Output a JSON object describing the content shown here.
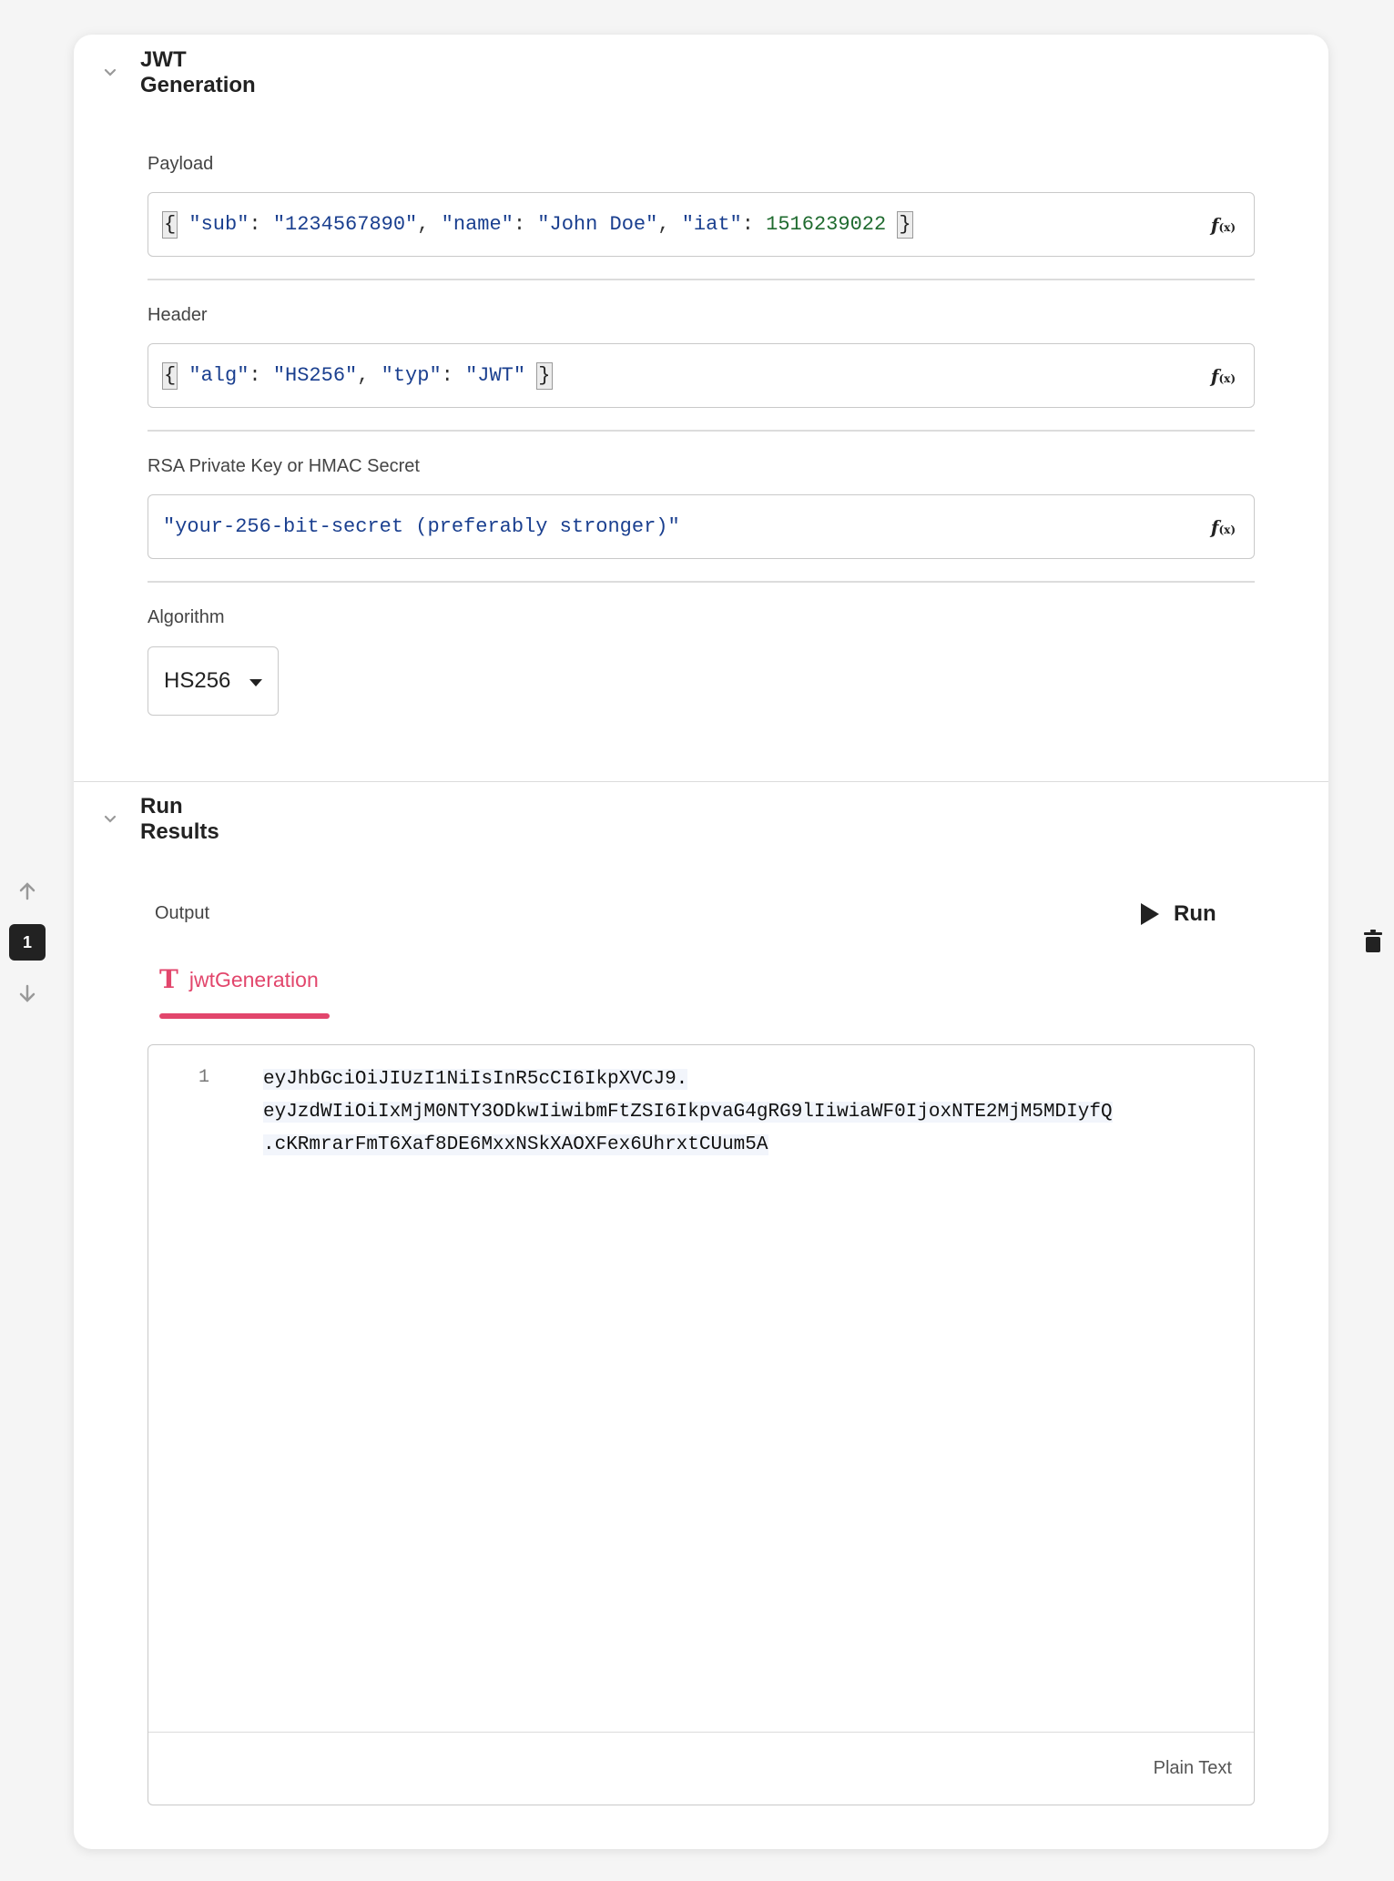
{
  "jwt_section": {
    "title": "JWT Generation",
    "fields": {
      "payload": {
        "label": "Payload",
        "tokens": [
          {
            "t": "{",
            "c": "brace"
          },
          {
            "t": " ",
            "c": "p"
          },
          {
            "t": "\"sub\"",
            "c": "k"
          },
          {
            "t": ": ",
            "c": "p"
          },
          {
            "t": "\"1234567890\"",
            "c": "k"
          },
          {
            "t": ", ",
            "c": "p"
          },
          {
            "t": "\"name\"",
            "c": "k"
          },
          {
            "t": ": ",
            "c": "p"
          },
          {
            "t": "\"John Doe\"",
            "c": "k"
          },
          {
            "t": ", ",
            "c": "p"
          },
          {
            "t": "\"iat\"",
            "c": "k"
          },
          {
            "t": ": ",
            "c": "p"
          },
          {
            "t": "1516239022",
            "c": "n"
          },
          {
            "t": " ",
            "c": "p"
          },
          {
            "t": "}",
            "c": "brace"
          }
        ]
      },
      "header": {
        "label": "Header",
        "tokens": [
          {
            "t": "{",
            "c": "brace"
          },
          {
            "t": " ",
            "c": "p"
          },
          {
            "t": "\"alg\"",
            "c": "k"
          },
          {
            "t": ": ",
            "c": "p"
          },
          {
            "t": "\"HS256\"",
            "c": "k"
          },
          {
            "t": ", ",
            "c": "p"
          },
          {
            "t": "\"typ\"",
            "c": "k"
          },
          {
            "t": ": ",
            "c": "p"
          },
          {
            "t": "\"JWT\"",
            "c": "k"
          },
          {
            "t": " ",
            "c": "p"
          },
          {
            "t": "}",
            "c": "brace"
          }
        ]
      },
      "secret": {
        "label": "RSA Private Key or HMAC Secret",
        "tokens": [
          {
            "t": "\"your-256-bit-secret (preferably stronger)\"",
            "c": "k"
          }
        ]
      },
      "algorithm": {
        "label": "Algorithm",
        "selected": "HS256"
      }
    },
    "fx_label": "f",
    "fx_sub": "(x)"
  },
  "run_section": {
    "title": "Run Results",
    "output_label": "Output",
    "run_label": "Run",
    "tab_icon": "T",
    "tab_label": "jwtGeneration",
    "line_number": "1",
    "output_lines": [
      "eyJhbGciOiJIUzI1NiIsInR5cCI6IkpXVCJ9.",
      "eyJzdWIiOiIxMjM0NTY3ODkwIiwibmFtZSI6IkpvaG4gRG9lIiwiaWF0IjoxNTE2MjM5MDIyfQ",
      ".cKRmrarFmT6Xaf8DE6MxxNSkXAOXFex6UhrxtCUum5A"
    ],
    "footer_label": "Plain Text"
  },
  "side_controls": {
    "step_number": "1"
  },
  "icons": {
    "collapse": "chevron-down-icon",
    "move_up": "arrow-up-icon",
    "move_down": "arrow-down-icon",
    "delete": "trash-icon",
    "run": "play-icon",
    "function": "fx-icon",
    "text_type": "text-type-icon"
  },
  "colors": {
    "accent": "#e2466c",
    "string": "#1a3f8f",
    "number": "#1f6b2f"
  }
}
